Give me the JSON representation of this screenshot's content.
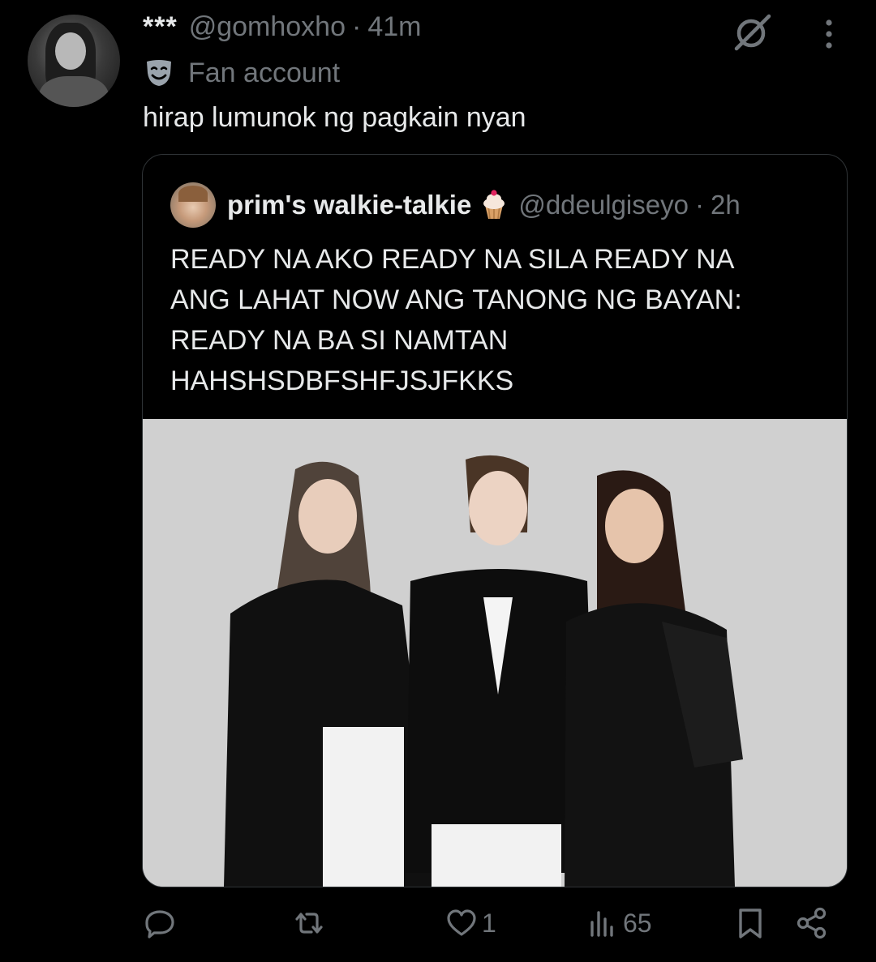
{
  "tweet": {
    "display_name": "***",
    "handle": "@gomhoxho",
    "separator": "·",
    "time": "41m",
    "label": "Fan account",
    "text": "hirap lumunok ng pagkain nyan"
  },
  "quoted": {
    "display_name": "prim's walkie-talkie",
    "handle": "@ddeulgiseyo",
    "separator": "·",
    "time": "2h",
    "text_lines": [
      "READY NA AKO READY NA SILA READY NA",
      "ANG LAHAT NOW ANG TANONG NG BAYAN:",
      "READY NA BA SI NAMTAN",
      "HAHSHSDBFSHFJSJFKKS"
    ]
  },
  "actions": {
    "reply_count": "",
    "retweet_count": "",
    "like_count": "1",
    "views_count": "65"
  },
  "icons": {
    "grok": "grok-icon",
    "more": "more-icon",
    "badge": "theater-mask-icon",
    "name_emoji": "cupcake-icon",
    "reply": "reply-icon",
    "retweet": "retweet-icon",
    "like": "heart-icon",
    "views": "views-icon",
    "bookmark": "bookmark-icon",
    "share": "share-icon"
  },
  "colors": {
    "background": "#000000",
    "text": "#e7e9ea",
    "muted": "#71767b",
    "border": "#2f3336"
  }
}
